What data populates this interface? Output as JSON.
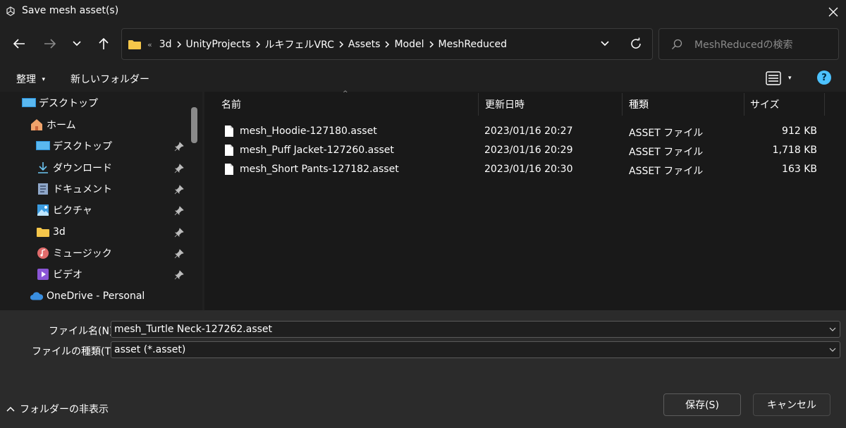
{
  "window": {
    "title": "Save mesh asset(s)"
  },
  "address": {
    "overflow": "«",
    "crumbs": [
      "3d",
      "UnityProjects",
      "ルキフェルVRC",
      "Assets",
      "Model",
      "MeshReduced"
    ]
  },
  "search": {
    "placeholder": "MeshReducedの検索"
  },
  "commands": {
    "organize": "整理",
    "new_folder": "新しいフォルダー"
  },
  "sidebar": {
    "items": [
      {
        "label": "デスクトップ",
        "icon": "desktop-icon",
        "pinned": false
      },
      {
        "label": "ホーム",
        "icon": "home-icon",
        "pinned": false
      },
      {
        "label": "デスクトップ",
        "icon": "desktop-icon",
        "pinned": true
      },
      {
        "label": "ダウンロード",
        "icon": "download-icon",
        "pinned": true
      },
      {
        "label": "ドキュメント",
        "icon": "document-icon",
        "pinned": true
      },
      {
        "label": "ピクチャ",
        "icon": "pictures-icon",
        "pinned": true
      },
      {
        "label": "3d",
        "icon": "folder-icon",
        "pinned": true
      },
      {
        "label": "ミュージック",
        "icon": "music-icon",
        "pinned": true
      },
      {
        "label": "ビデオ",
        "icon": "video-icon",
        "pinned": true
      },
      {
        "label": "OneDrive - Personal",
        "icon": "cloud-icon",
        "pinned": false
      }
    ]
  },
  "table": {
    "columns": {
      "name": "名前",
      "date": "更新日時",
      "type": "種類",
      "size": "サイズ"
    },
    "rows": [
      {
        "name": "mesh_Hoodie-127180.asset",
        "date": "2023/01/16 20:27",
        "type": "ASSET ファイル",
        "size": "912 KB"
      },
      {
        "name": "mesh_Puff Jacket-127260.asset",
        "date": "2023/01/16 20:29",
        "type": "ASSET ファイル",
        "size": "1,718 KB"
      },
      {
        "name": "mesh_Short Pants-127182.asset",
        "date": "2023/01/16 20:30",
        "type": "ASSET ファイル",
        "size": "163 KB"
      }
    ]
  },
  "form": {
    "filename_label": "ファイル名(N):",
    "filename_value": "mesh_Turtle Neck-127262.asset",
    "filetype_label": "ファイルの種類(T):",
    "filetype_value": "asset (*.asset)"
  },
  "footer": {
    "hide_folders": "フォルダーの非表示",
    "save": "保存(S)",
    "cancel": "キャンセル"
  },
  "colors": {
    "accent": "#4cc2ff",
    "folder": "#f5c64a"
  }
}
